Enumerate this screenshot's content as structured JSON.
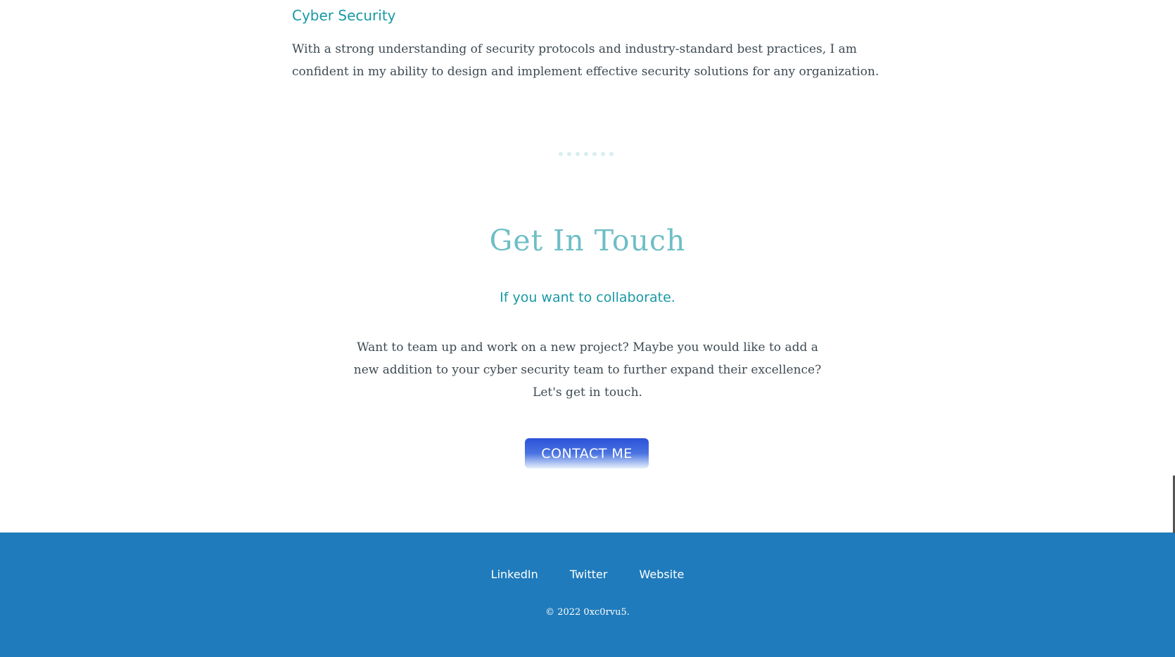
{
  "skill": {
    "title": "Cyber Security",
    "description": "With a strong understanding of security protocols and industry-standard best practices, I am confident in my ability to design and implement effective security solutions for any organization."
  },
  "contact": {
    "title": "Get In Touch",
    "subtitle": "If you want to collaborate.",
    "body": "Want to team up and work on a new project? Maybe you would like to add a new addition to your cyber security team to further expand their excellence? Let's get in touch.",
    "button_label": "CONTACT ME"
  },
  "footer": {
    "links": [
      "LinkedIn",
      "Twitter",
      "Website"
    ],
    "copyright": "© 2022 0xc0rvu5."
  },
  "colors": {
    "accent": "#1899a5",
    "heading": "#6ebec6",
    "footer_bg": "#1f7bbb",
    "button": "#2b52d6"
  }
}
